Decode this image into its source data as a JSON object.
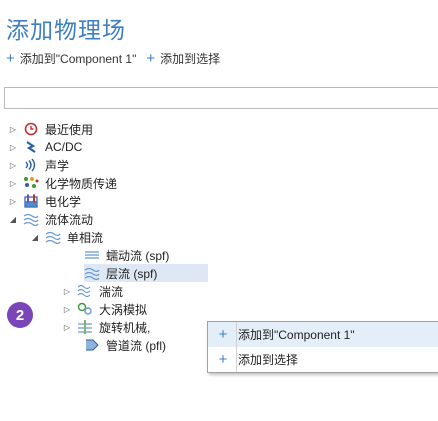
{
  "header": {
    "title": "添加物理场",
    "add_to_component": "添加到\"Component 1\"",
    "add_to_selection": "添加到选择"
  },
  "search": {
    "value": "",
    "placeholder": ""
  },
  "tree": {
    "items": [
      {
        "label": "最近使用",
        "icon": "recent-icon"
      },
      {
        "label": "AC/DC",
        "icon": "acdc-icon"
      },
      {
        "label": "声学",
        "icon": "acoustics-icon"
      },
      {
        "label": "化学物质传递",
        "icon": "chemical-transport-icon"
      },
      {
        "label": "电化学",
        "icon": "electrochemistry-icon"
      },
      {
        "label": "流体流动",
        "icon": "fluid-flow-icon"
      },
      {
        "label": "单相流",
        "icon": "single-phase-flow-icon"
      },
      {
        "label": "蠕动流 (spf)",
        "icon": "creeping-flow-icon"
      },
      {
        "label": "层流 (spf)",
        "icon": "laminar-flow-icon"
      },
      {
        "label": "湍流",
        "icon": "turbulent-flow-icon"
      },
      {
        "label": "大涡模拟",
        "icon": "les-icon"
      },
      {
        "label": "旋转机械,",
        "icon": "rotating-machinery-icon"
      },
      {
        "label": "管道流 (pfl)",
        "icon": "pipe-flow-icon"
      }
    ]
  },
  "callout": {
    "number": "2"
  },
  "context_menu": {
    "add_to_component": "添加到\"Component 1\"",
    "add_to_selection": "添加到选择"
  },
  "colors": {
    "accent": "#3d7fc4",
    "badge": "#7a45b8",
    "selection": "#dde8f4"
  }
}
